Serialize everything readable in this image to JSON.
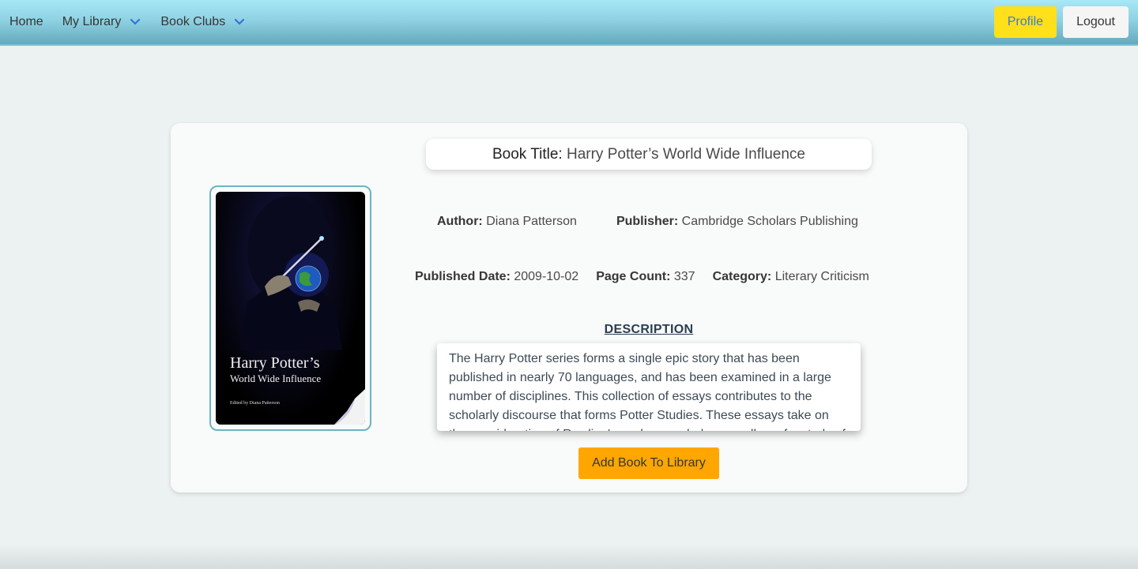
{
  "nav": {
    "home": "Home",
    "my_library": "My Library",
    "book_clubs": "Book Clubs",
    "profile": "Profile",
    "logout": "Logout"
  },
  "book": {
    "title_label": "Book Title:",
    "title": "Harry Potter’s World Wide Influence",
    "author_label": "Author:",
    "author": "Diana Patterson",
    "publisher_label": "Publisher:",
    "publisher": "Cambridge Scholars Publishing",
    "published_date_label": "Published Date:",
    "published_date": "2009-10-02",
    "page_count_label": "Page Count:",
    "page_count": "337",
    "category_label": "Category:",
    "category": "Literary Criticism",
    "description_heading": "DESCRIPTION",
    "description": "The Harry Potter series forms a single epic story that has been published in nearly 70 languages, and has been examined in a large number of disciplines. This collection of essays contributes to the scholarly discourse that forms Potter Studies. These essays take on the consideration of Rowling's work as a whole, as well as of a study of the series' influence across the world."
  },
  "cover": {
    "title_line1": "Harry Potter’s",
    "title_line2": "World Wide Influence",
    "editor": "Edited by Diana Patterson"
  },
  "actions": {
    "add_to_library": "Add Book To Library"
  },
  "colors": {
    "navbar": "#8fd2e3",
    "profile_button": "#ffe01b",
    "add_button": "#ffa600",
    "cover_border": "#6bb5c3"
  }
}
